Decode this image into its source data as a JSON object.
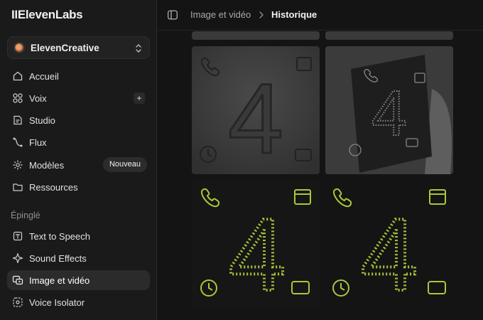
{
  "app": {
    "logo": "IIElevenLabs"
  },
  "workspace": {
    "name": "ElevenCreative"
  },
  "nav": {
    "accueil": "Accueil",
    "voix": "Voix",
    "voix_add": "+",
    "studio": "Studio",
    "flux": "Flux",
    "modeles": "Modèles",
    "modeles_badge": "Nouveau",
    "ressources": "Ressources"
  },
  "pinned": {
    "label": "Épinglé",
    "items": [
      "Text to Speech",
      "Sound Effects",
      "Image et vidéo",
      "Voice Isolator"
    ]
  },
  "breadcrumb": {
    "parent": "Image et vidéo",
    "current": "Historique"
  },
  "gallery": {
    "tiles": [
      {
        "glyph": "4",
        "style": "embossed-gray"
      },
      {
        "glyph": "4",
        "style": "notebook-gray"
      },
      {
        "glyph": "4",
        "style": "particles-lime"
      },
      {
        "glyph": "4",
        "style": "particles-lime"
      }
    ]
  },
  "colors": {
    "accent_lime": "#a8c83a",
    "sidebar_bg": "#1a1a1a",
    "main_bg": "#141414"
  }
}
